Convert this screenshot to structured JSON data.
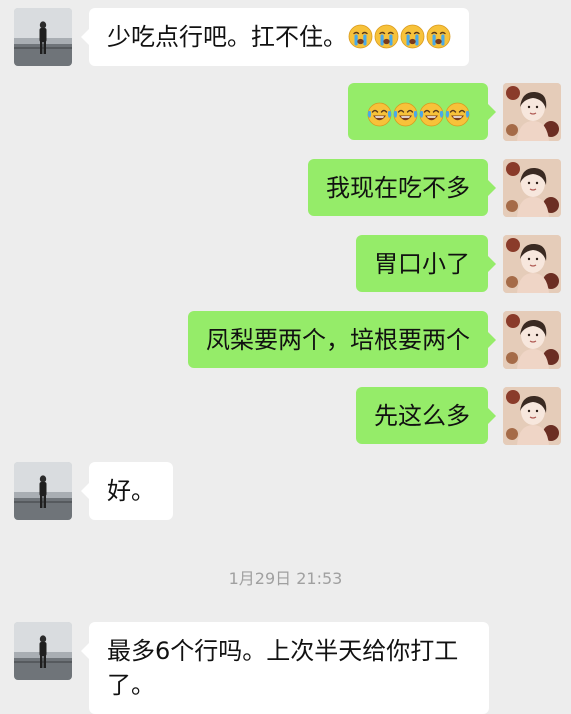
{
  "chat": {
    "messages": [
      {
        "sender": "other",
        "text": "少吃点行吧。扛不住。",
        "emoji": [
          "crying-face",
          "crying-face",
          "crying-face",
          "crying-face"
        ]
      },
      {
        "sender": "self",
        "text": "",
        "emoji": [
          "laughing-crying-face",
          "laughing-crying-face",
          "laughing-crying-face",
          "laughing-crying-face"
        ]
      },
      {
        "sender": "self",
        "text": "我现在吃不多"
      },
      {
        "sender": "self",
        "text": "胃口小了"
      },
      {
        "sender": "self",
        "text": "凤梨要两个，培根要两个"
      },
      {
        "sender": "self",
        "text": "先这么多"
      },
      {
        "sender": "other",
        "text": "好。"
      },
      {
        "sender": "other",
        "text": "最多6个行吗。上次半天给你打工了。"
      }
    ],
    "timestamp": "1月29日 21:53"
  },
  "colors": {
    "background": "#ededed",
    "self_bubble": "#95ec69",
    "other_bubble": "#ffffff",
    "timestamp_text": "#a0a0a0"
  }
}
